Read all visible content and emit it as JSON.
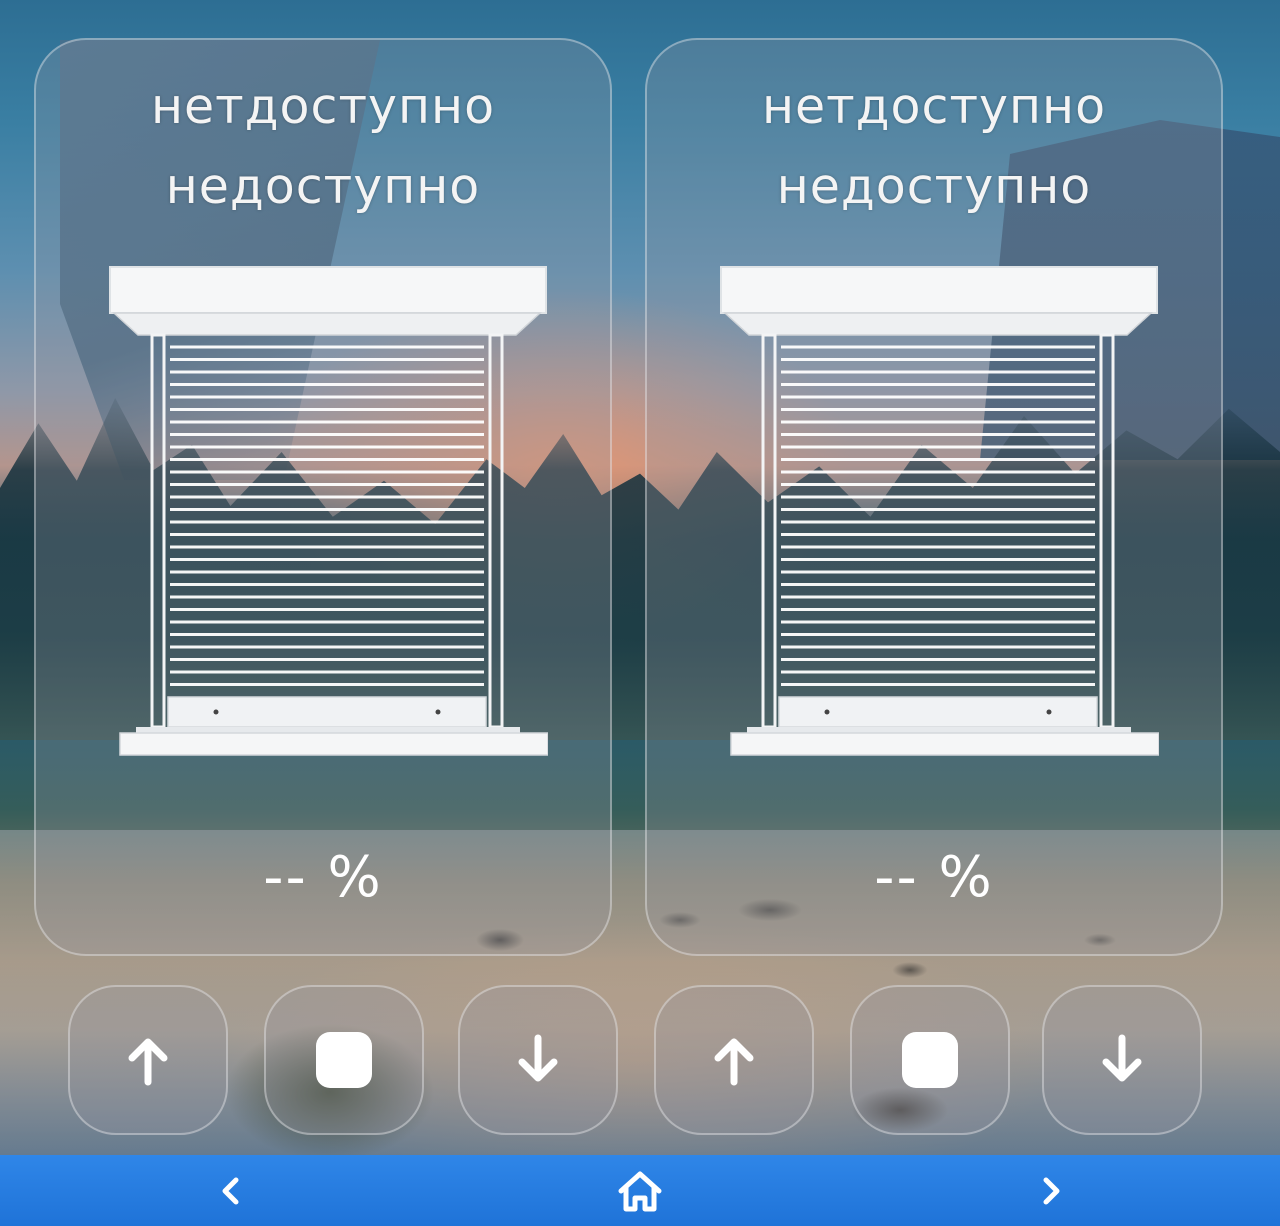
{
  "shutters": [
    {
      "status_line1": "нетдоступно",
      "status_line2": "недоступно",
      "percent": "-- %"
    },
    {
      "status_line1": "нетдоступно",
      "status_line2": "недоступно",
      "percent": "-- %"
    }
  ],
  "controls": {
    "up_icon": "arrow-up-icon",
    "stop_icon": "stop-square-icon",
    "down_icon": "arrow-down-icon"
  },
  "navbar": {
    "prev_icon": "chevron-left-icon",
    "home_icon": "home-icon",
    "next_icon": "chevron-right-icon",
    "color": "#2a80e2"
  },
  "colors": {
    "text": "#f4f4f4",
    "icon": "#ffffff",
    "card_bg": "rgba(150,150,160,0.28)"
  }
}
